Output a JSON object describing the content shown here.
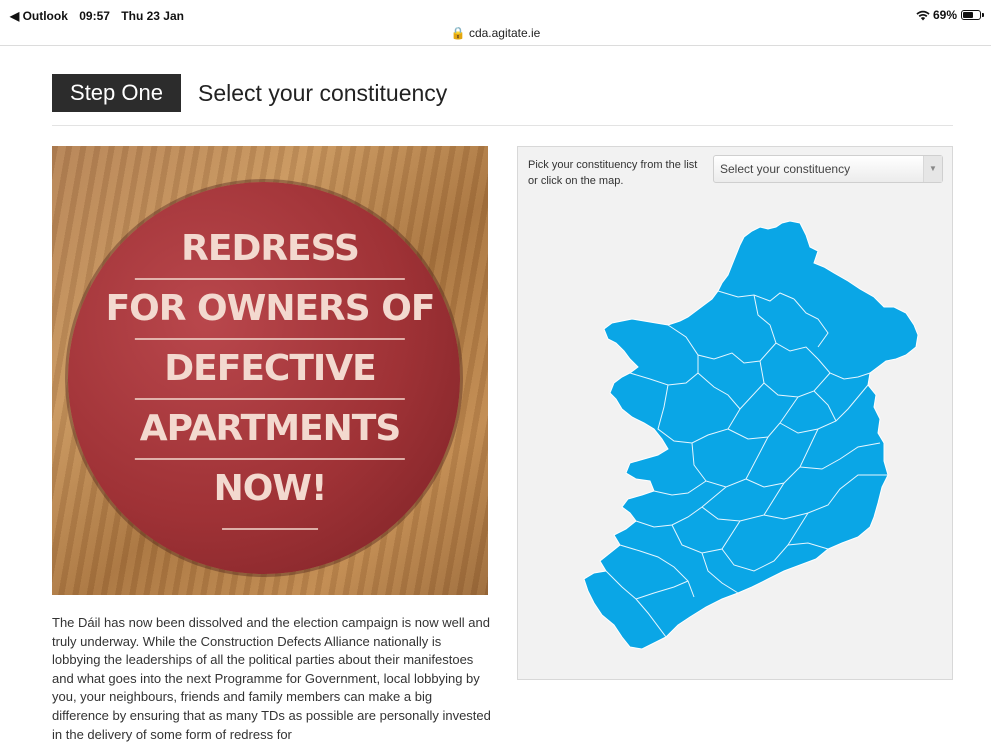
{
  "status_bar": {
    "back_app": "◀ Outlook",
    "time": "09:57",
    "date": "Thu 23 Jan",
    "url": "cda.agitate.ie",
    "battery": "69%",
    "battery_level": 0.69
  },
  "step": {
    "badge": "Step One",
    "title": "Select your constituency"
  },
  "pin_badge": {
    "lines": [
      "REDRESS",
      "FOR OWNERS OF",
      "DEFECTIVE",
      "APARTMENTS",
      "NOW!"
    ]
  },
  "body": {
    "paragraph": "The Dáil has now been dissolved and the election campaign is now well and truly underway. While the Construction Defects Alliance nationally is lobbying the leaderships of all the political parties about their manifestoes and what goes into the next Programme for Government, local lobbying by you, your neighbours, friends and family members can make a big difference by ensuring that as many TDs as possible are personally invested in the delivery of some form of redress for"
  },
  "map_panel": {
    "instructions": "Pick your constituency from the list or click on the map.",
    "select_value": "Select your constituency",
    "map_color": "#0aa6e6"
  }
}
